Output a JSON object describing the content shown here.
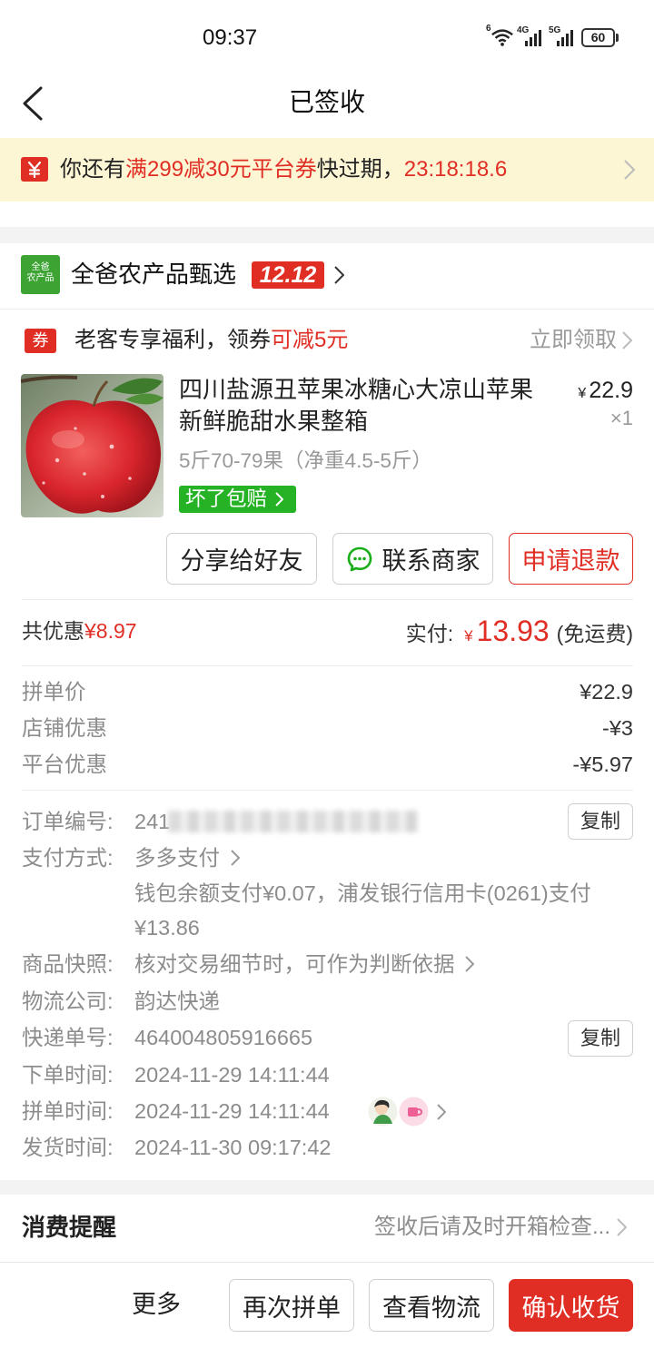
{
  "theme": {
    "accent": "#e02e24",
    "green": "#25b325",
    "banner": "#fdf6d5",
    "logo": "#3da434",
    "wechat": "#1aad19"
  },
  "icons": {
    "back": "back-chevron-icon",
    "wifi": "wifi-icon",
    "signal": "signal-icon",
    "battery": "battery-icon",
    "banner_coupon": "coupon-yen-icon",
    "chevron": "chevron-right-icon",
    "contact": "chat-bubble-icon"
  },
  "status_bar": {
    "time": "09:37",
    "wifi_label": "6",
    "network1": "4G",
    "network2": "5G",
    "battery": "60"
  },
  "header": {
    "title": "已签收"
  },
  "banner": {
    "prefix": "你还有",
    "coupon": "满299减30元平台券",
    "middle": "快过期，",
    "countdown": "23:18:18.6"
  },
  "store": {
    "logo_line1": "全爸",
    "logo_line2": "农产品",
    "name": "全爸农产品甄选",
    "badge": "12.12"
  },
  "coupon_row": {
    "icon_text": "券",
    "text": "老客专享福利，领券",
    "highlight": "可减5元",
    "action": "立即领取"
  },
  "product": {
    "title": "四川盐源丑苹果冰糖心大凉山苹果新鲜脆甜水果整箱",
    "currency": "¥",
    "price": "22.9",
    "quantity": "×1",
    "spec": "5斤70-79果（净重4.5-5斤）",
    "guarantee": "坏了包赔"
  },
  "actions": {
    "share": "分享给好友",
    "contact": "联系商家",
    "refund": "申请退款"
  },
  "totals": {
    "discount_label": "共优惠",
    "discount_value": "¥8.97",
    "paid_label": "实付:",
    "currency": "¥",
    "paid_value": "13.93",
    "shipping": "(免运费)"
  },
  "price_details": [
    {
      "label": "拼单价",
      "value": "¥22.9"
    },
    {
      "label": "店铺优惠",
      "value": "-¥3"
    },
    {
      "label": "平台优惠",
      "value": "-¥5.97"
    }
  ],
  "order_info": {
    "order_no": {
      "label": "订单编号:",
      "value_visible": "241",
      "copy": "复制"
    },
    "payment": {
      "label": "支付方式:",
      "value": "多多支付",
      "detail_line1": "钱包余额支付¥0.07，浦发银行信用卡(0261)支付",
      "detail_line2": "¥13.86"
    },
    "snapshot": {
      "label": "商品快照:",
      "value": "核对交易细节时，可作为判断依据"
    },
    "logistics_company": {
      "label": "物流公司:",
      "value": "韵达快递"
    },
    "tracking_no": {
      "label": "快递单号:",
      "value": "464004805916665",
      "copy": "复制"
    },
    "order_time": {
      "label": "下单时间:",
      "value": "2024-11-29 14:11:44"
    },
    "group_time": {
      "label": "拼单时间:",
      "value": "2024-11-29 14:11:44"
    },
    "ship_time": {
      "label": "发货时间:",
      "value": "2024-11-30 09:17:42"
    }
  },
  "reminder": {
    "title": "消费提醒",
    "text": "签收后请及时开箱检查..."
  },
  "bottom_bar": {
    "more": "更多",
    "reorder": "再次拼单",
    "logistics": "查看物流",
    "confirm": "确认收货"
  }
}
